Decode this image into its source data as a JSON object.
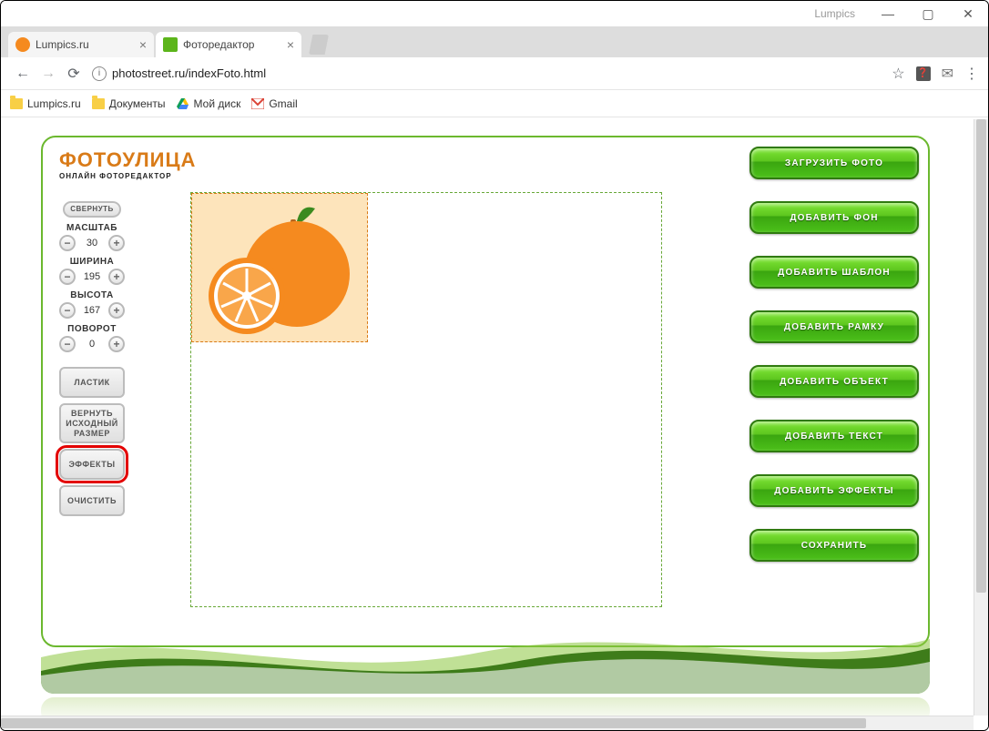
{
  "window": {
    "title": "Lumpics"
  },
  "tabs": [
    {
      "title": "Lumpics.ru",
      "favicon_color": "#f58a1f"
    },
    {
      "title": "Фоторедактор",
      "favicon_color": "#5cb51b"
    }
  ],
  "address": {
    "url": "photostreet.ru/indexFoto.html"
  },
  "bookmarks": [
    {
      "label": "Lumpics.ru",
      "icon": "folder"
    },
    {
      "label": "Документы",
      "icon": "folder"
    },
    {
      "label": "Мой диск",
      "icon": "drive"
    },
    {
      "label": "Gmail",
      "icon": "gmail"
    }
  ],
  "logo": {
    "line1": "ФОТОУЛИЦА",
    "line2": "ОНЛАЙН ФОТОРЕДАКТОР"
  },
  "left_panel": {
    "collapse": "СВЕРНУТЬ",
    "controls": [
      {
        "label": "МАСШТАБ",
        "value": "30"
      },
      {
        "label": "ШИРИНА",
        "value": "195"
      },
      {
        "label": "ВЫСОТА",
        "value": "167"
      },
      {
        "label": "ПОВОРОТ",
        "value": "0"
      }
    ],
    "tools": {
      "eraser": "ЛАСТИК",
      "reset_size": "ВЕРНУТЬ ИСХОДНЫЙ РАЗМЕР",
      "effects": "ЭФФЕКТЫ",
      "clear": "ОЧИСТИТЬ"
    }
  },
  "right_panel": [
    "ЗАГРУЗИТЬ ФОТО",
    "ДОБАВИТЬ ФОН",
    "ДОБАВИТЬ ШАБЛОН",
    "ДОБАВИТЬ РАМКУ",
    "ДОБАВИТЬ ОБЪЕКТ",
    "ДОБАВИТЬ ТЕКСТ",
    "ДОБАВИТЬ ЭФФЕКТЫ",
    "СОХРАНИТЬ"
  ],
  "canvas": {
    "selection": {
      "width": 194,
      "height": 164
    }
  }
}
